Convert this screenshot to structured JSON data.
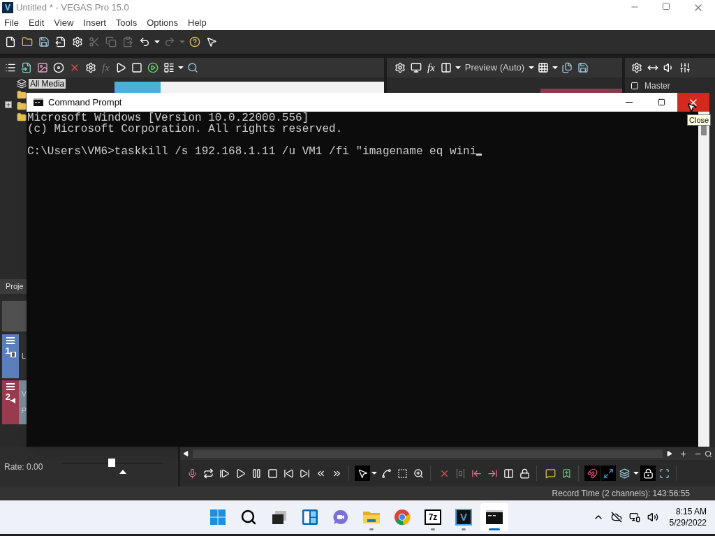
{
  "vegas": {
    "logo": "V",
    "title": "Untitled * - VEGAS Pro 15.0",
    "menu": [
      "File",
      "Edit",
      "View",
      "Insert",
      "Tools",
      "Options",
      "Help"
    ],
    "main_toolbar": [
      {
        "kind": "page",
        "disabled": false
      },
      {
        "kind": "folder",
        "disabled": false
      },
      {
        "kind": "floppy-disk",
        "disabled": false
      },
      {
        "kind": "export",
        "disabled": false
      },
      {
        "kind": "gear",
        "disabled": false
      },
      {
        "kind": "scissors",
        "disabled": true
      },
      {
        "kind": "copy",
        "disabled": true
      },
      {
        "kind": "paste",
        "disabled": true
      },
      {
        "kind": "undo",
        "disabled": false
      },
      {
        "kind": "caret",
        "disabled": false
      },
      {
        "kind": "redo",
        "disabled": true
      },
      {
        "kind": "caret",
        "disabled": true
      },
      {
        "kind": "help-pointer",
        "disabled": false
      },
      {
        "kind": "question-pointer",
        "disabled": false
      }
    ],
    "explorer_toolbar": [
      {
        "kind": "list",
        "disabled": false
      },
      {
        "kind": "import",
        "disabled": false
      },
      {
        "kind": "image",
        "disabled": false
      },
      {
        "kind": "disc",
        "disabled": false
      },
      {
        "kind": "delete",
        "disabled": false
      },
      {
        "kind": "gear",
        "disabled": false
      },
      {
        "kind": "fx",
        "label": "fx",
        "disabled": true
      },
      {
        "kind": "play",
        "disabled": false
      },
      {
        "kind": "stop",
        "disabled": false
      },
      {
        "kind": "play-circle",
        "disabled": false
      },
      {
        "kind": "layout-list",
        "disabled": false
      },
      {
        "kind": "caret",
        "disabled": false
      },
      {
        "kind": "search",
        "disabled": false
      }
    ],
    "preview_toolbar": [
      {
        "kind": "gear",
        "disabled": false
      },
      {
        "kind": "monitor",
        "disabled": false
      },
      {
        "kind": "fx",
        "label": "fx",
        "disabled": false
      },
      {
        "kind": "split",
        "disabled": false
      },
      {
        "kind": "caret",
        "disabled": false
      },
      {
        "kind": "text",
        "label": "Preview (Auto)",
        "disabled": false
      },
      {
        "kind": "caret",
        "disabled": false
      },
      {
        "kind": "grid",
        "disabled": false
      },
      {
        "kind": "caret",
        "disabled": false
      },
      {
        "kind": "files",
        "disabled": false
      },
      {
        "kind": "floppy-disk",
        "disabled": false
      }
    ],
    "mixer_toolbar": [
      {
        "kind": "gear",
        "disabled": false
      },
      {
        "kind": "bowtie",
        "disabled": false
      },
      {
        "kind": "volume",
        "disabled": false
      },
      {
        "kind": "sliders",
        "disabled": false
      }
    ],
    "media_filter": "All Media",
    "master_label": "Master",
    "timeline_tab": "Proje",
    "tracks": [
      {
        "number": "1",
        "kind": "video",
        "color": "#5b7fbd",
        "names": [
          "L"
        ]
      },
      {
        "number": "2",
        "kind": "audio",
        "color": "#9a3a50",
        "names": [
          "V",
          "P"
        ]
      }
    ],
    "rate": "Rate: 0.00",
    "rate_slider": {
      "level": 0.49
    },
    "transport": [
      [
        {
          "kind": "mic",
          "disabled": false,
          "selected": false
        },
        {
          "kind": "loop",
          "disabled": false,
          "selected": false
        },
        {
          "kind": "play-start",
          "disabled": false,
          "selected": false
        },
        {
          "kind": "play",
          "disabled": false,
          "selected": false
        },
        {
          "kind": "pause",
          "disabled": false,
          "selected": false
        },
        {
          "kind": "stop",
          "disabled": false,
          "selected": false
        },
        {
          "kind": "skip-back",
          "disabled": false,
          "selected": false
        },
        {
          "kind": "skip-forward",
          "disabled": false,
          "selected": false
        },
        {
          "kind": "prev-frame",
          "disabled": false,
          "selected": false
        },
        {
          "kind": "next-frame",
          "disabled": false,
          "selected": false
        }
      ],
      [
        {
          "kind": "pointer",
          "disabled": false,
          "selected": true
        },
        {
          "kind": "caret",
          "disabled": false,
          "selected": false
        },
        {
          "kind": "envelope",
          "disabled": false,
          "selected": false
        },
        {
          "kind": "selection",
          "disabled": false,
          "selected": false
        },
        {
          "kind": "zoom",
          "disabled": false,
          "selected": false
        }
      ],
      [
        {
          "kind": "delete",
          "disabled": false,
          "selected": false
        },
        {
          "kind": "trim",
          "disabled": true,
          "selected": false
        },
        {
          "kind": "trim-start",
          "disabled": false,
          "selected": false
        },
        {
          "kind": "trim-end",
          "disabled": false,
          "selected": false
        },
        {
          "kind": "split",
          "disabled": false,
          "selected": false
        },
        {
          "kind": "lock",
          "disabled": false,
          "selected": false
        }
      ],
      [
        {
          "kind": "marker",
          "disabled": false,
          "selected": false
        },
        {
          "kind": "region",
          "disabled": false,
          "selected": false
        }
      ],
      [
        {
          "kind": "magnet",
          "disabled": false,
          "selected": true
        },
        {
          "kind": "crossfade",
          "disabled": false,
          "selected": true
        },
        {
          "kind": "ripple",
          "disabled": false,
          "selected": false
        },
        {
          "kind": "caret",
          "disabled": false,
          "selected": false
        },
        {
          "kind": "lock-envelope",
          "disabled": false,
          "selected": true
        },
        {
          "kind": "group-select",
          "disabled": false,
          "selected": false
        }
      ]
    ],
    "status": "Record Time (2 channels): 143:56:55"
  },
  "cmd": {
    "title": "Command Prompt",
    "banner": [
      "Microsoft Windows [Version 10.0.22000.556]",
      "(c) Microsoft Corporation. All rights reserved."
    ],
    "prompt": "C:\\Users\\VM6>taskkill /s 192.168.1.11 /u VM1 /fi \"imagename eq wini",
    "tooltip": "Close"
  },
  "taskbar": {
    "apps": [
      {
        "kind": "start",
        "open": false,
        "selected": false
      },
      {
        "kind": "search",
        "open": false,
        "selected": false
      },
      {
        "kind": "task-view",
        "open": false,
        "selected": false
      },
      {
        "kind": "widgets",
        "open": false,
        "selected": false
      },
      {
        "kind": "chat",
        "open": false,
        "selected": false
      },
      {
        "kind": "folder",
        "open": true,
        "selected": false
      },
      {
        "kind": "browser",
        "open": false,
        "selected": false
      },
      {
        "kind": "archiver",
        "label": "7z",
        "open": true,
        "selected": false
      },
      {
        "kind": "vegas",
        "label": "V",
        "open": true,
        "selected": false
      },
      {
        "kind": "terminal",
        "open": true,
        "selected": true
      }
    ],
    "time": "8:15 AM",
    "date": "5/29/2022"
  }
}
